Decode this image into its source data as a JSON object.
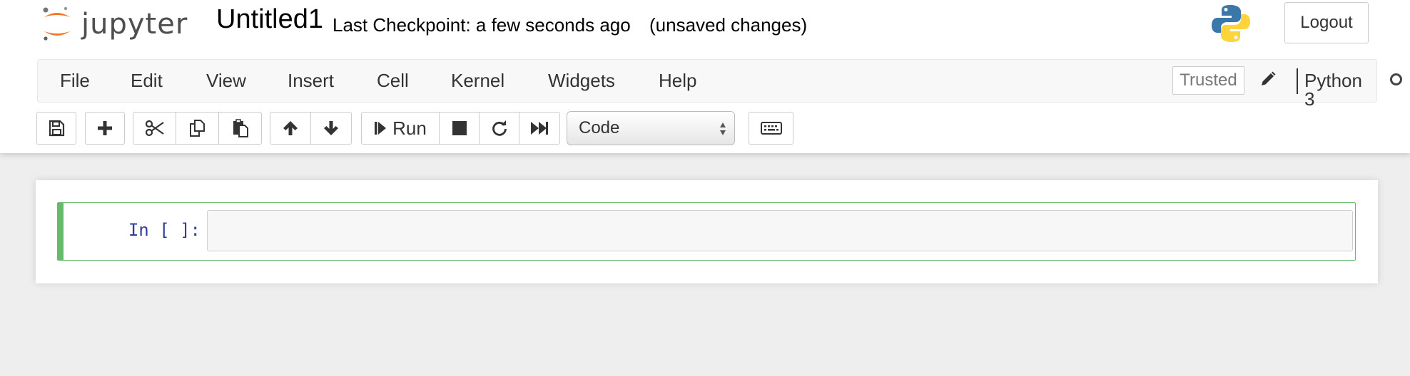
{
  "header": {
    "logo_text": "jupyter",
    "notebook_title": "Untitled1",
    "checkpoint_status": "Last Checkpoint: a few seconds ago",
    "autosave_status": "(unsaved changes)",
    "logout_label": "Logout",
    "python_logo_icon": "python-logo-icon"
  },
  "menubar": {
    "items": [
      "File",
      "Edit",
      "View",
      "Insert",
      "Cell",
      "Kernel",
      "Widgets",
      "Help"
    ],
    "trusted_label": "Trusted",
    "kernel_name": "Python 3",
    "kernel_status": "idle"
  },
  "toolbar": {
    "buttons": [
      {
        "name": "save",
        "icon": "floppy-disk-icon"
      },
      {
        "name": "insert-cell-below",
        "icon": "plus-icon"
      },
      {
        "name": "cut",
        "icon": "scissors-icon"
      },
      {
        "name": "copy",
        "icon": "copy-icon"
      },
      {
        "name": "paste",
        "icon": "paste-icon"
      },
      {
        "name": "move-up",
        "icon": "arrow-up-icon"
      },
      {
        "name": "move-down",
        "icon": "arrow-down-icon"
      },
      {
        "name": "run",
        "icon": "step-forward-icon"
      },
      {
        "name": "interrupt",
        "icon": "stop-icon"
      },
      {
        "name": "restart",
        "icon": "refresh-icon"
      },
      {
        "name": "restart-run-all",
        "icon": "fast-forward-icon"
      },
      {
        "name": "command-palette",
        "icon": "keyboard-icon"
      }
    ],
    "run_label": "Run",
    "cell_type": "Code"
  },
  "notebook": {
    "cells": [
      {
        "prompt": "In [ ]:",
        "source": ""
      }
    ]
  },
  "colors": {
    "accent_cell_border": "#66bb6a",
    "prompt_color": "#303f9f",
    "jupyter_orange": "#f37726"
  }
}
